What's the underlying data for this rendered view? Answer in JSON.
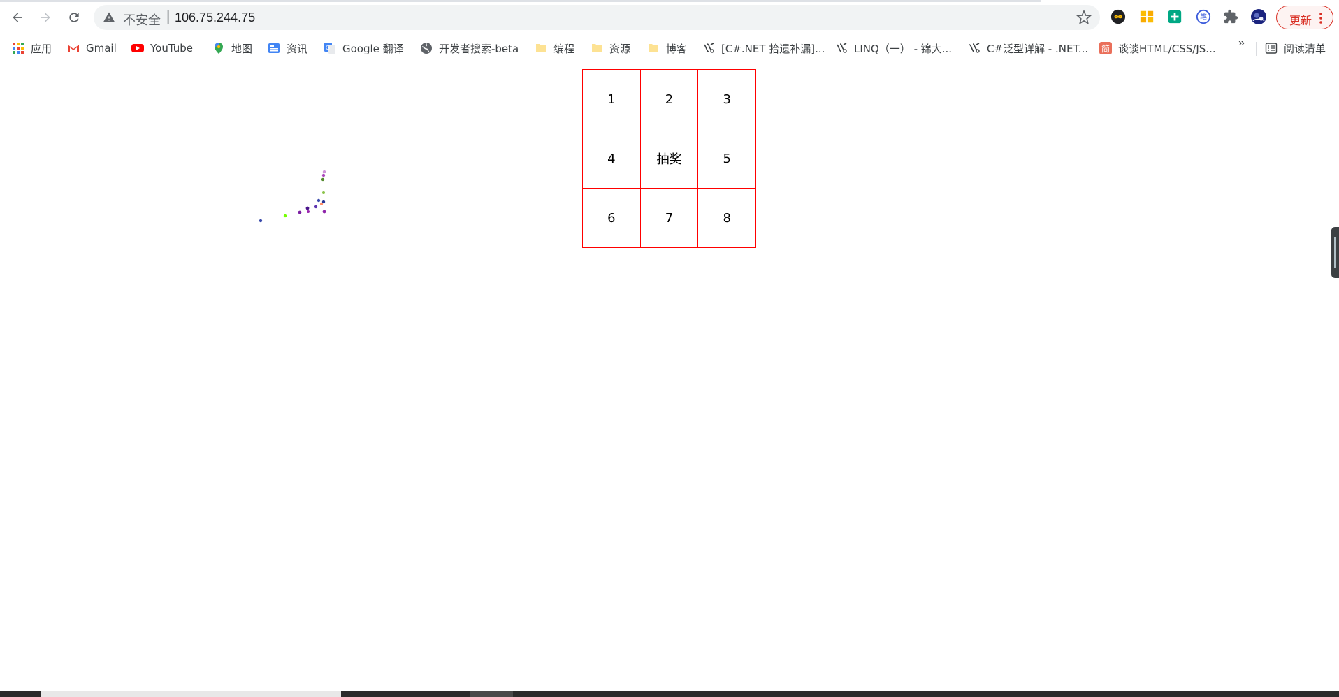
{
  "browser": {
    "security_label": "不安全",
    "separator": "|",
    "url": "106.75.244.75",
    "update_label": "更新"
  },
  "bookmarks": [
    {
      "label": "应用",
      "icon": "apps-grid-icon"
    },
    {
      "label": "Gmail",
      "icon": "gmail-icon"
    },
    {
      "label": "YouTube",
      "icon": "youtube-icon"
    },
    {
      "label": "地图",
      "icon": "maps-pin-icon"
    },
    {
      "label": "资讯",
      "icon": "news-icon"
    },
    {
      "label": "Google 翻译",
      "icon": "translate-icon"
    },
    {
      "label": "开发者搜索-beta",
      "icon": "globe-icon"
    },
    {
      "label": "编程",
      "icon": "folder-icon"
    },
    {
      "label": "资源",
      "icon": "folder-icon"
    },
    {
      "label": "博客",
      "icon": "folder-icon"
    },
    {
      "label": "[C#.NET 拾遗补漏]...",
      "icon": "cnblogs-icon"
    },
    {
      "label": "LINQ（一） - 锦大...",
      "icon": "cnblogs-icon"
    },
    {
      "label": "C#泛型详解 - .NET...",
      "icon": "cnblogs-icon"
    },
    {
      "label": "谈谈HTML/CSS/JS...",
      "icon": "jianshu-icon"
    }
  ],
  "bookmarks_overflow": "»",
  "reading_list": {
    "label": "阅读清单",
    "icon": "reading-list-icon"
  },
  "lottery": {
    "rows": [
      [
        "1",
        "2",
        "3"
      ],
      [
        "4",
        "抽奖",
        "5"
      ],
      [
        "6",
        "7",
        "8"
      ]
    ],
    "border_color": "#ff0000"
  },
  "colors": {
    "update_red": "#d93025",
    "omnibox_bg": "#f1f3f4"
  }
}
